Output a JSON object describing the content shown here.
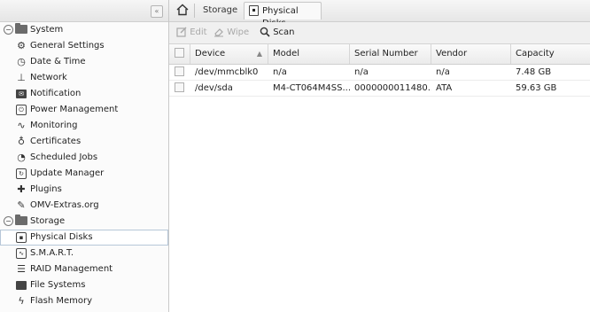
{
  "nav": {
    "collapse_glyph": "«",
    "groups": [
      {
        "label": "System",
        "toggle": "−",
        "items": [
          {
            "label": "General Settings",
            "icon": "general-settings-icon"
          },
          {
            "label": "Date & Time",
            "icon": "clock-icon"
          },
          {
            "label": "Network",
            "icon": "network-icon"
          },
          {
            "label": "Notification",
            "icon": "mail-icon"
          },
          {
            "label": "Power Management",
            "icon": "power-icon"
          },
          {
            "label": "Monitoring",
            "icon": "chart-line-icon"
          },
          {
            "label": "Certificates",
            "icon": "certificate-icon"
          },
          {
            "label": "Scheduled Jobs",
            "icon": "scheduled-jobs-icon"
          },
          {
            "label": "Update Manager",
            "icon": "update-icon"
          },
          {
            "label": "Plugins",
            "icon": "puzzle-icon"
          },
          {
            "label": "OMV-Extras.org",
            "icon": "wrench-icon"
          }
        ]
      },
      {
        "label": "Storage",
        "toggle": "−",
        "items": [
          {
            "label": "Physical Disks",
            "icon": "disk-icon",
            "selected": true
          },
          {
            "label": "S.M.A.R.T.",
            "icon": "smart-icon"
          },
          {
            "label": "RAID Management",
            "icon": "raid-icon"
          },
          {
            "label": "File Systems",
            "icon": "filesystem-icon"
          },
          {
            "label": "Flash Memory",
            "icon": "flash-icon"
          }
        ]
      }
    ]
  },
  "tabs": {
    "parent": "Storage",
    "active": "Physical Disks"
  },
  "toolbar": {
    "edit_label": "Edit",
    "wipe_label": "Wipe",
    "scan_label": "Scan"
  },
  "grid": {
    "columns": [
      "Device",
      "Model",
      "Serial Number",
      "Vendor",
      "Capacity"
    ],
    "sort_indicator": "▲",
    "rows": [
      {
        "device": "/dev/mmcblk0",
        "model": "n/a",
        "serial": "n/a",
        "vendor": "n/a",
        "capacity": "7.48 GB"
      },
      {
        "device": "/dev/sda",
        "model": "M4-CT064M4SS...",
        "serial": "0000000011480...",
        "vendor": "ATA",
        "capacity": "59.63 GB"
      }
    ]
  },
  "colors": {
    "selection_outline": "#b7c7d8",
    "panel_bg": "#fbfbfb"
  }
}
